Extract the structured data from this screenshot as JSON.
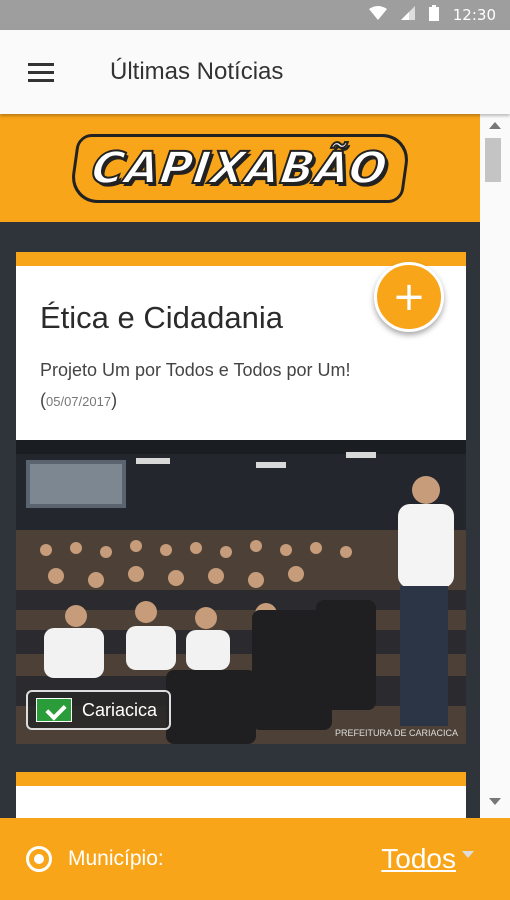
{
  "status_bar": {
    "time": "12:30",
    "icons": [
      "wifi-icon",
      "signal-icon",
      "battery-icon"
    ]
  },
  "app_bar": {
    "title": "Últimas Notícias",
    "menu_icon": "hamburger-menu-icon"
  },
  "logo": {
    "text": "CAPIXABÃO"
  },
  "news": [
    {
      "title": "Ética e Cidadania",
      "subtitle": "Projeto Um por Todos e Todos por Um!",
      "date_open": "(",
      "date": "05/07/2017",
      "date_close": ")",
      "city": "Cariacica",
      "image_watermark": "PREFEITURA DE CARIACICA"
    }
  ],
  "fab": {
    "label": "+"
  },
  "bottom_bar": {
    "label": "Município:",
    "selected": "Todos"
  },
  "colors": {
    "accent": "#f9a51a",
    "background": "#2f343a",
    "statusbar": "#9e9e9e"
  }
}
